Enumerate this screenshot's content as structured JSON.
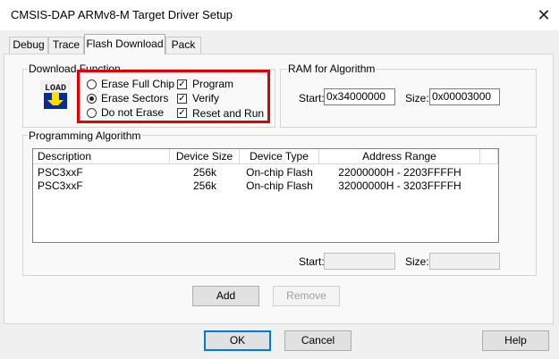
{
  "window": {
    "title": "CMSIS-DAP ARMv8-M Target Driver Setup",
    "close_glyph": "✕"
  },
  "tabs": [
    {
      "label": "Debug",
      "active": false
    },
    {
      "label": "Trace",
      "active": false
    },
    {
      "label": "Flash Download",
      "active": true
    },
    {
      "label": "Pack",
      "active": false
    }
  ],
  "download_function": {
    "group_label": "Download Function",
    "icon": "load-icon",
    "icon_text": "LOAD",
    "erase_options": [
      {
        "label": "Erase Full Chip",
        "selected": false
      },
      {
        "label": "Erase Sectors",
        "selected": true
      },
      {
        "label": "Do not Erase",
        "selected": false
      }
    ],
    "checks": [
      {
        "label": "Program",
        "checked": true
      },
      {
        "label": "Verify",
        "checked": true
      },
      {
        "label": "Reset and Run",
        "checked": true
      }
    ],
    "highlight_color": "#e00000"
  },
  "ram": {
    "group_label": "RAM for Algorithm",
    "start_label": "Start:",
    "start_value": "0x34000000",
    "size_label": "Size:",
    "size_value": "0x00003000"
  },
  "programming": {
    "group_label": "Programming Algorithm",
    "columns": [
      "Description",
      "Device Size",
      "Device Type",
      "Address Range"
    ],
    "rows": [
      [
        "PSC3xxF",
        "256k",
        "On-chip Flash",
        "22000000H - 2203FFFFH"
      ],
      [
        "PSC3xxF",
        "256k",
        "On-chip Flash",
        "32000000H - 3203FFFFH"
      ]
    ],
    "start_label": "Start:",
    "start_value": "",
    "size_label": "Size:",
    "size_value": ""
  },
  "buttons": {
    "add": "Add",
    "remove": "Remove",
    "ok": "OK",
    "cancel": "Cancel",
    "help": "Help"
  }
}
